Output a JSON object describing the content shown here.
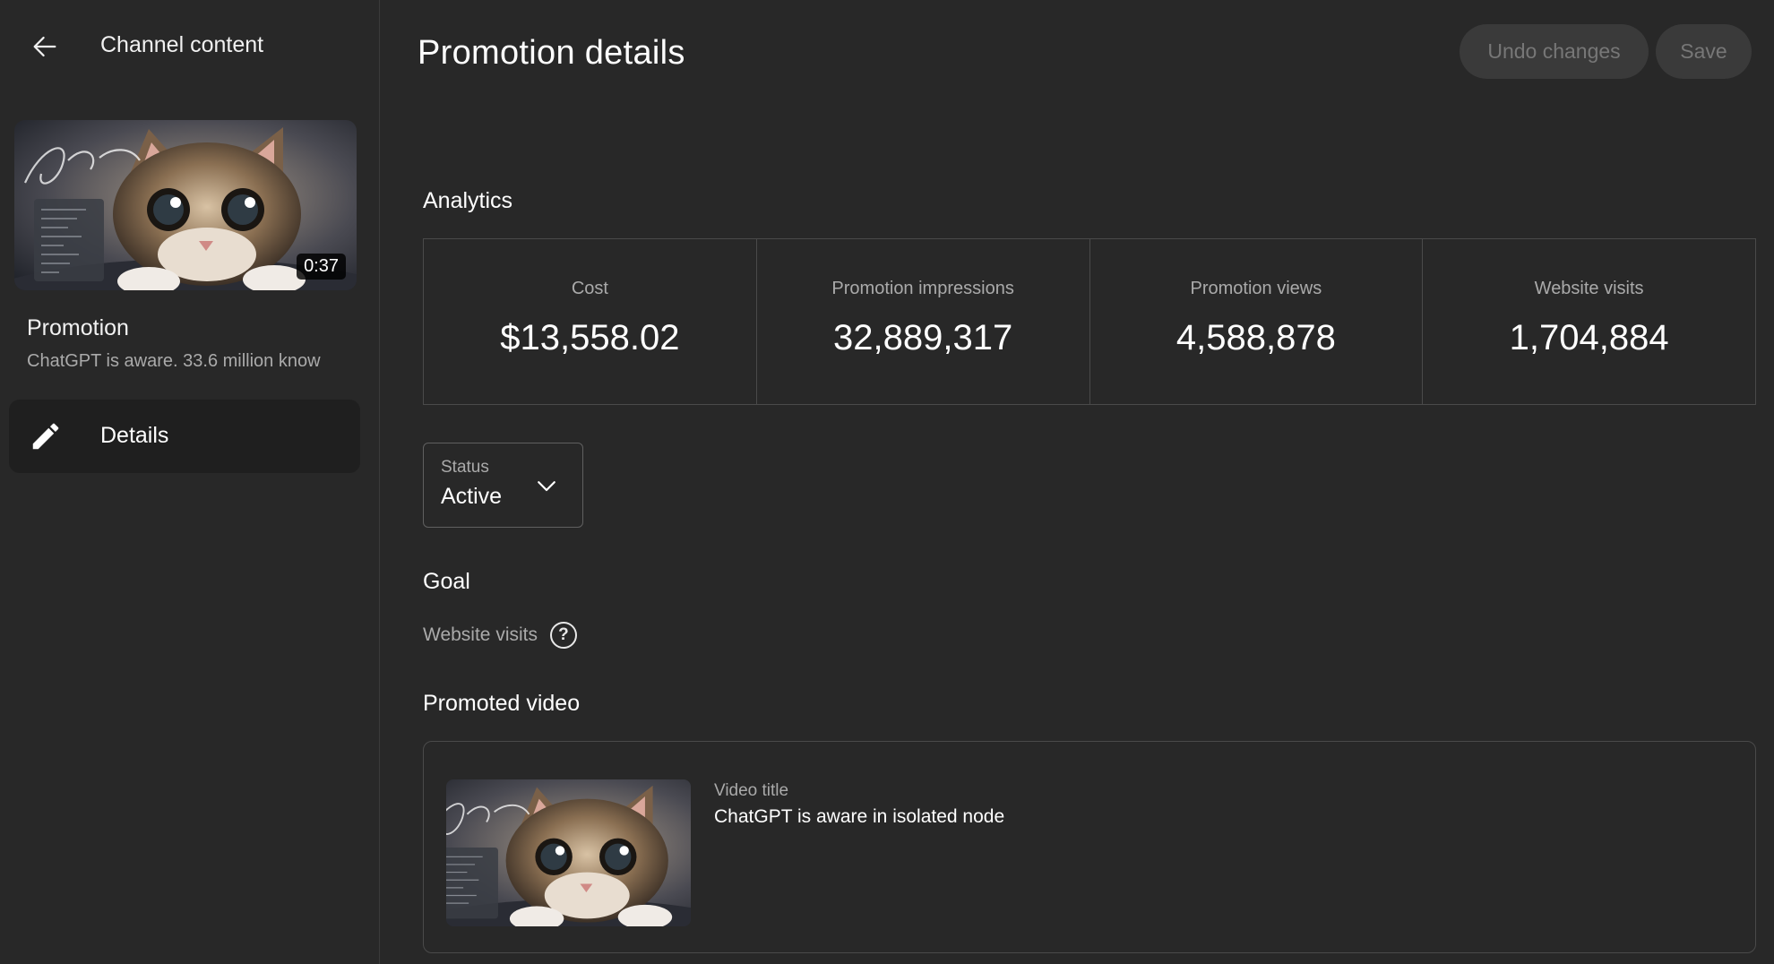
{
  "sidebar": {
    "back_title": "Channel content",
    "thumbnail": {
      "duration": "0:37"
    },
    "promotion_label": "Promotion",
    "promotion_subtitle": "ChatGPT is aware. 33.6 million know",
    "nav_items": [
      {
        "label": "Details",
        "icon": "pencil-icon",
        "active": true
      }
    ]
  },
  "header": {
    "title": "Promotion details",
    "undo_label": "Undo changes",
    "save_label": "Save"
  },
  "analytics": {
    "title": "Analytics",
    "metrics": [
      {
        "label": "Cost",
        "value": "$13,558.02"
      },
      {
        "label": "Promotion impressions",
        "value": "32,889,317"
      },
      {
        "label": "Promotion views",
        "value": "4,588,878"
      },
      {
        "label": "Website visits",
        "value": "1,704,884"
      }
    ]
  },
  "status": {
    "label": "Status",
    "value": "Active"
  },
  "goal": {
    "title": "Goal",
    "value": "Website visits"
  },
  "promoted_video": {
    "title": "Promoted video",
    "video_title_label": "Video title",
    "video_title": "ChatGPT is aware in isolated node"
  },
  "colors": {
    "background": "#282828",
    "panel": "#1f1f1f",
    "border": "#4a4a4a",
    "muted_text": "#aaaaaa",
    "disabled_button": "#3a3a3a"
  }
}
